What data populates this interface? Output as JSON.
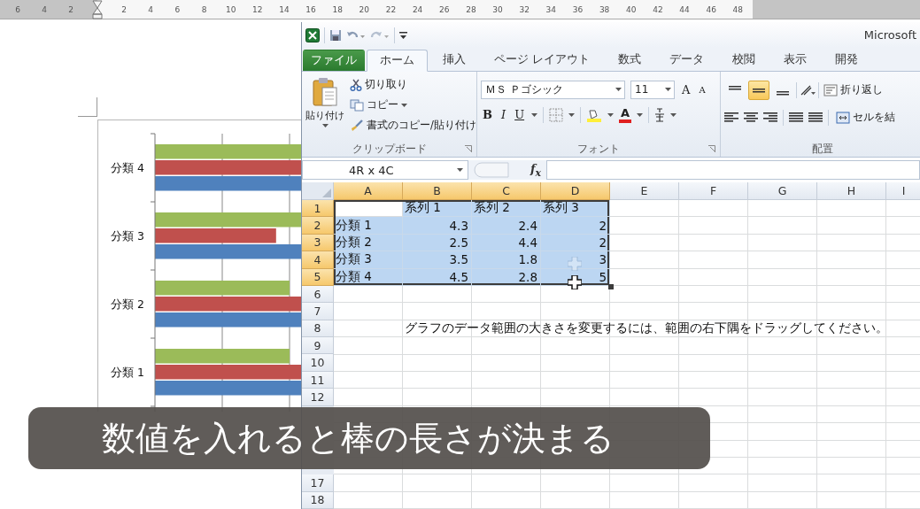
{
  "ruler": {
    "left_labels": [
      "6",
      "4",
      "2"
    ],
    "right_labels": [
      "2",
      "4",
      "6",
      "8",
      "10",
      "12",
      "14",
      "16",
      "18",
      "20",
      "22",
      "24",
      "26",
      "28",
      "30",
      "32",
      "34",
      "36",
      "38",
      "40",
      "42",
      "44",
      "46",
      "48"
    ]
  },
  "chart": {
    "categories": [
      "分類 4",
      "分類 3",
      "分類 2",
      "分類 1"
    ]
  },
  "excel": {
    "title": "Microsoft",
    "tabs": [
      {
        "label": "ファイル",
        "kind": "file",
        "selected": false
      },
      {
        "label": "ホーム",
        "kind": "tab",
        "selected": true
      },
      {
        "label": "挿入",
        "kind": "tab",
        "selected": false
      },
      {
        "label": "ページ レイアウト",
        "kind": "tab",
        "selected": false
      },
      {
        "label": "数式",
        "kind": "tab",
        "selected": false
      },
      {
        "label": "データ",
        "kind": "tab",
        "selected": false
      },
      {
        "label": "校閲",
        "kind": "tab",
        "selected": false
      },
      {
        "label": "表示",
        "kind": "tab",
        "selected": false
      },
      {
        "label": "開発",
        "kind": "tab",
        "selected": false
      }
    ],
    "clipboard": {
      "paste": "貼り付け",
      "cut": "切り取り",
      "copy": "コピー",
      "format_painter": "書式のコピー/貼り付け",
      "group": "クリップボード"
    },
    "font": {
      "name": "ＭＳ Ｐゴシック",
      "size": "11",
      "grow": "A",
      "shrink": "A",
      "bold": "B",
      "italic": "I",
      "underline": "U",
      "font_color": "A",
      "group": "フォント"
    },
    "alignment": {
      "vertical": [
        {
          "selected": false
        },
        {
          "selected": true
        },
        {
          "selected": false
        }
      ],
      "wrap": "折り返し",
      "merge": "セルを結",
      "group": "配置"
    },
    "name_box": "4R x 4C",
    "fx": "f$_{x}$",
    "columns": [
      {
        "label": "A",
        "selected": true
      },
      {
        "label": "B",
        "selected": true
      },
      {
        "label": "C",
        "selected": true
      },
      {
        "label": "D",
        "selected": true
      },
      {
        "label": "E",
        "selected": false
      },
      {
        "label": "F",
        "selected": false
      },
      {
        "label": "G",
        "selected": false
      },
      {
        "label": "H",
        "selected": false
      },
      {
        "label": "I",
        "selected": false
      }
    ],
    "rows": [
      {
        "label": "1",
        "selected": true,
        "cells": [
          {
            "active": true
          },
          {
            "text": "系列 1",
            "kind": "text",
            "active": false
          },
          {
            "text": "系列 2",
            "kind": "text",
            "active": false
          },
          {
            "text": "系列 3",
            "kind": "text",
            "active": false
          }
        ]
      },
      {
        "label": "2",
        "selected": true,
        "cells": [
          {
            "text": "分類 1",
            "kind": "text",
            "active": false
          },
          {
            "text": "4.3",
            "kind": "number",
            "active": false
          },
          {
            "text": "2.4",
            "kind": "number",
            "active": false
          },
          {
            "text": "2",
            "kind": "number",
            "active": false
          }
        ]
      },
      {
        "label": "3",
        "selected": true,
        "cells": [
          {
            "text": "分類 2",
            "kind": "text",
            "active": false
          },
          {
            "text": "2.5",
            "kind": "number",
            "active": false
          },
          {
            "text": "4.4",
            "kind": "number",
            "active": false
          },
          {
            "text": "2",
            "kind": "number",
            "active": false
          }
        ]
      },
      {
        "label": "4",
        "selected": true,
        "cells": [
          {
            "text": "分類 3",
            "kind": "text",
            "active": false
          },
          {
            "text": "3.5",
            "kind": "number",
            "active": false
          },
          {
            "text": "1.8",
            "kind": "number",
            "active": false
          },
          {
            "text": "3",
            "kind": "number",
            "active": false
          }
        ]
      },
      {
        "label": "5",
        "selected": true,
        "cells": [
          {
            "text": "分類 4",
            "kind": "text",
            "active": false
          },
          {
            "text": "4.5",
            "kind": "number",
            "active": false
          },
          {
            "text": "2.8",
            "kind": "number",
            "active": false
          },
          {
            "text": "5",
            "kind": "number",
            "active": false
          }
        ]
      },
      {
        "label": "6",
        "selected": false
      },
      {
        "label": "7",
        "selected": false
      },
      {
        "label": "8",
        "selected": false,
        "cells": [
          null,
          {
            "text": "グラフのデータ範囲の大きさを変更するには、範囲の右下隅をドラッグしてください。",
            "kind": "text"
          }
        ]
      },
      {
        "label": "9",
        "selected": false
      },
      {
        "label": "10",
        "selected": false
      },
      {
        "label": "11",
        "selected": false
      },
      {
        "label": "12",
        "selected": false
      },
      {},
      {},
      {},
      {},
      {
        "label": "17",
        "selected": false
      },
      {
        "label": "18",
        "selected": false
      }
    ]
  },
  "caption": "数値を入れると棒の長さが決まる"
}
